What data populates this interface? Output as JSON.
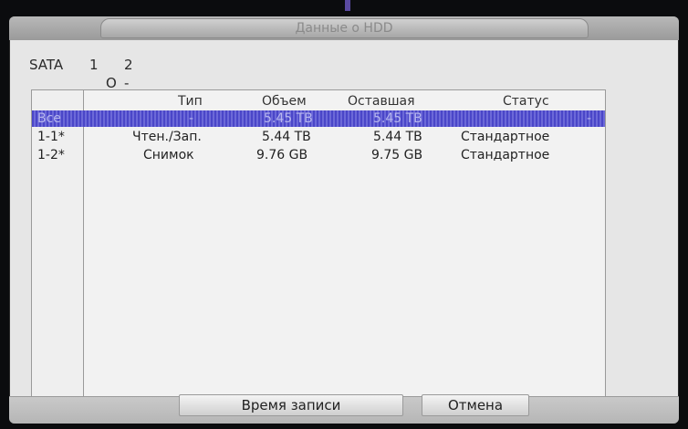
{
  "window": {
    "title": "Данные о HDD"
  },
  "sata": {
    "label": "SATA",
    "ports": [
      {
        "num": "1",
        "status": "O"
      },
      {
        "num": "2",
        "status": "-"
      }
    ]
  },
  "table": {
    "headers": [
      "Тип",
      "Объем",
      "Оставшая",
      "Статус"
    ],
    "rows": [
      {
        "id": "Все",
        "type": "-",
        "capacity": "5.45 TB",
        "remaining": "5.45 TB",
        "status": "-",
        "selected": true
      },
      {
        "id": "1-1*",
        "type": "Чтен./Зап.",
        "capacity": "5.44 TB",
        "remaining": "5.44 TB",
        "status": "Стандартное",
        "selected": false
      },
      {
        "id": "1-2*",
        "type": "Снимок",
        "capacity": "9.76 GB",
        "remaining": "9.75 GB",
        "status": "Стандартное",
        "selected": false
      }
    ]
  },
  "buttons": {
    "record_time": "Время записи",
    "cancel": "Отмена"
  },
  "colors": {
    "selection": "#5552d0",
    "panel_bg": "#e6e6e6"
  }
}
